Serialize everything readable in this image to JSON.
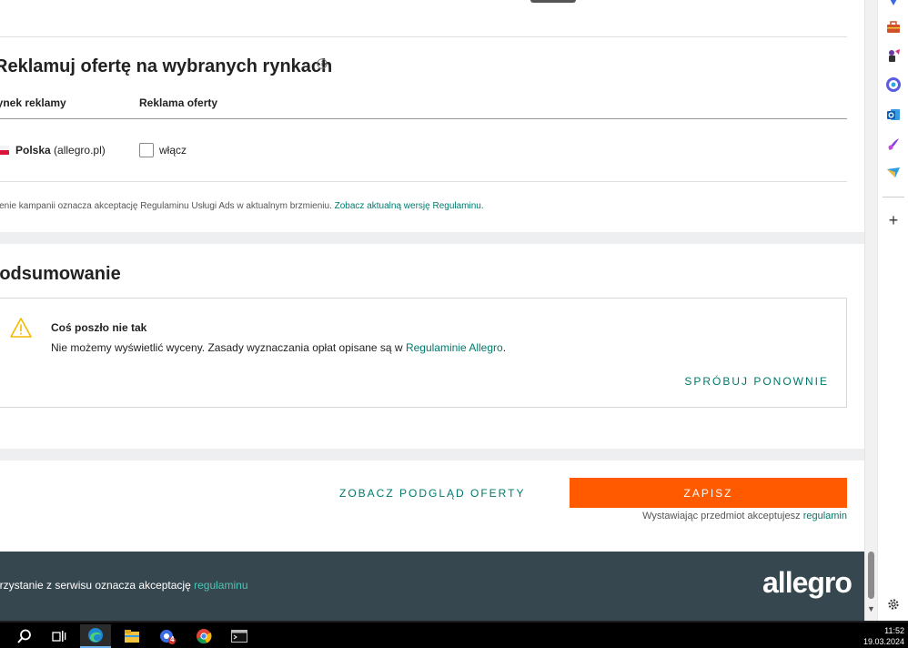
{
  "ads_section": {
    "title": "Reklamuj ofertę na wybranych rynkach",
    "col_market": "Rynek reklamy",
    "col_ad": "Reklama oferty",
    "row": {
      "country": "Polska",
      "domain": "(allegro.pl)",
      "checkbox_label": "włącz"
    },
    "terms_text": "Utworzenie kampanii oznacza akceptację Regulaminu Usługi Ads w aktualnym brzmieniu.",
    "terms_link": "Zobacz aktualną wersję Regulaminu."
  },
  "summary": {
    "title": "Podsumowanie",
    "alert_title": "Coś poszło nie tak",
    "alert_text": "Nie możemy wyświetlić wyceny. Zasady wyznaczania opłat opisane są w",
    "alert_link": "Regulaminie Allegro",
    "alert_period": ".",
    "retry_label": "SPRÓBUJ PONOWNIE"
  },
  "actions": {
    "preview_label": "ZOBACZ PODGLĄD OFERTY",
    "save_label": "ZAPISZ",
    "accept_text": "Wystawiając przedmiot akceptujesz",
    "accept_link": "regulamin"
  },
  "footer": {
    "text": "Korzystanie z serwisu oznacza akceptację",
    "link": "regulaminu",
    "logo": "allegro"
  },
  "taskbar": {
    "time": "11:52",
    "date": "19.03.2024",
    "outlook_badge": "4"
  },
  "colors": {
    "accent": "#00796b",
    "orange": "#ff5a00",
    "footer_bg": "#37474f",
    "warning": "#f5b800"
  }
}
